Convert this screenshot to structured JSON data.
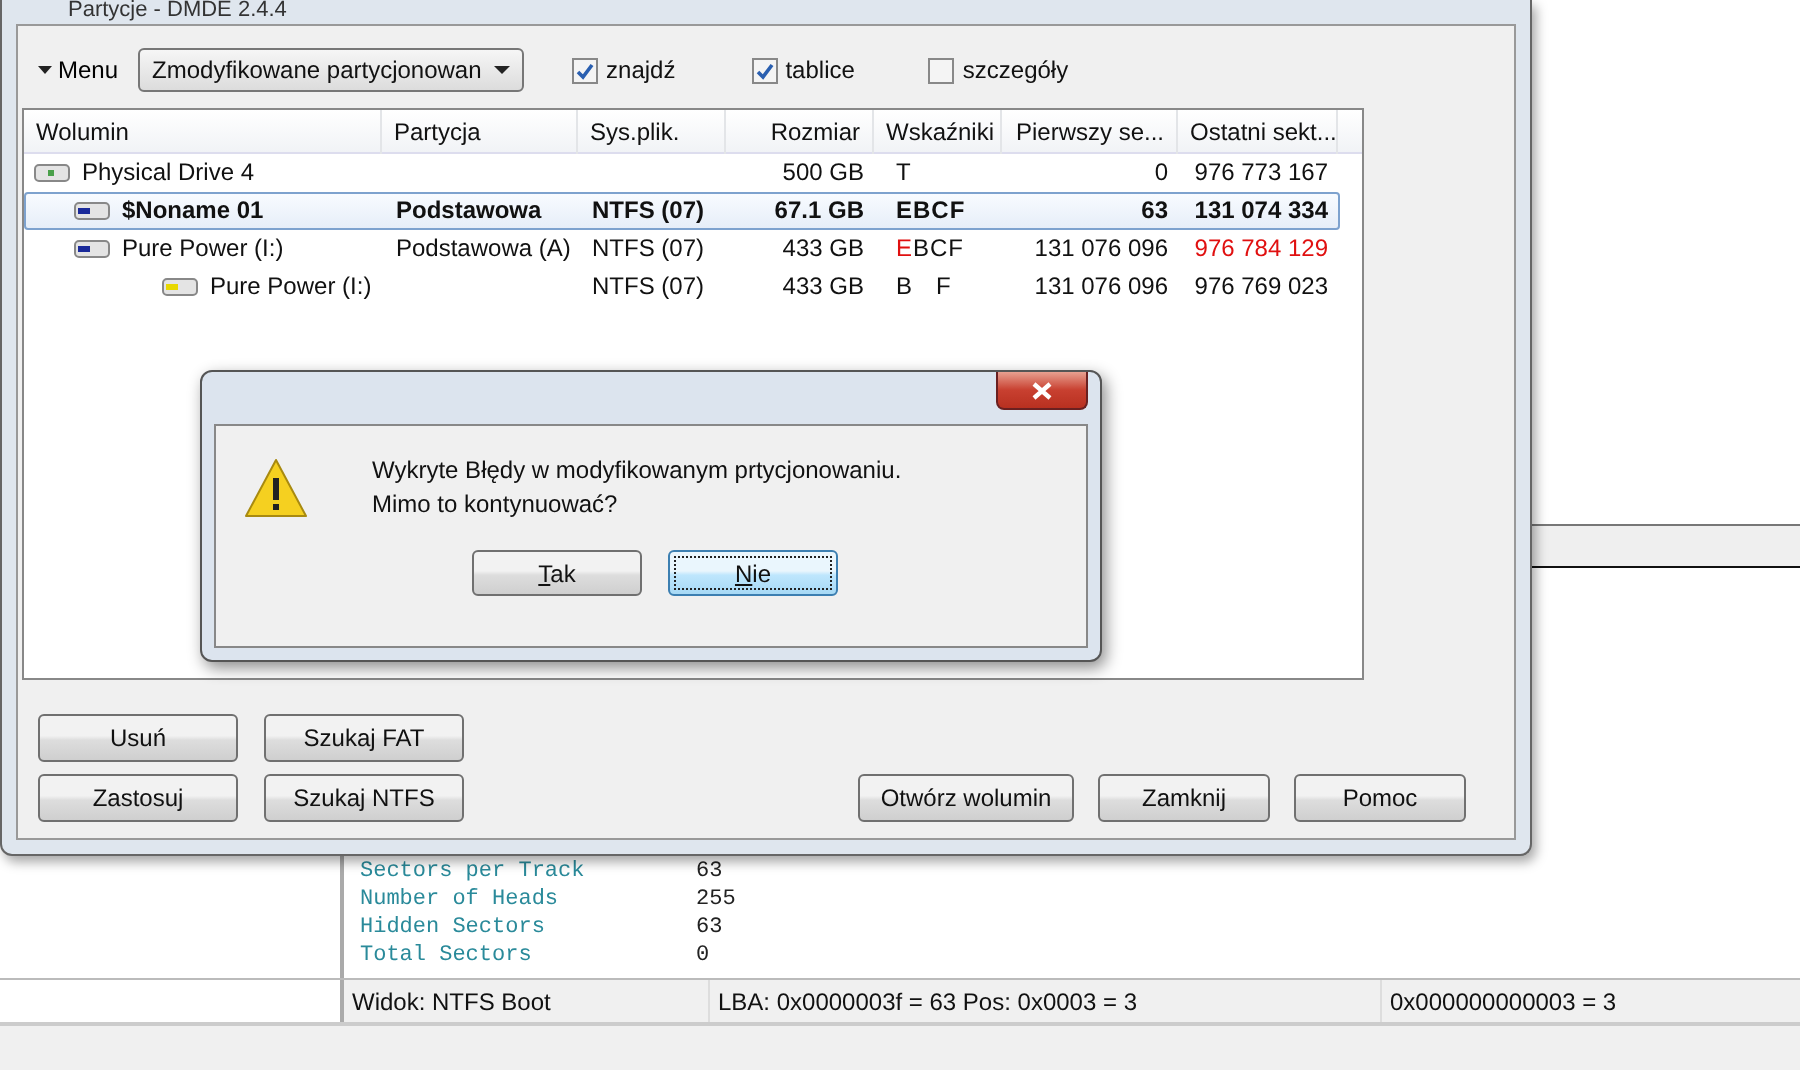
{
  "window": {
    "title": "Partycje - DMDE 2.4.4"
  },
  "toolbar": {
    "menu": "Menu",
    "view_select": "Zmodyfikowane partycjonowan",
    "checkboxes": [
      {
        "label": "znajdź",
        "checked": true
      },
      {
        "label": "tablice",
        "checked": true
      },
      {
        "label": "szczegóły",
        "checked": false
      }
    ]
  },
  "table": {
    "columns": [
      "Wolumin",
      "Partycja",
      "Sys.plik.",
      "Rozmiar",
      "Wskaźniki",
      "Pierwszy se...",
      "Ostatni sekt..."
    ],
    "rows": [
      {
        "kind": "drive",
        "name": "Physical Drive 4",
        "size": "500 GB",
        "flags": [
          {
            "text": "T",
            "error": false
          }
        ],
        "first_sector": "0",
        "last_sector": "976 773 167",
        "last_sector_error": false,
        "selected": false,
        "children": [
          {
            "kind": "partition",
            "name": "$Noname 01",
            "partition": "Podstawowa",
            "fs": "NTFS (07)",
            "size": "67.1 GB",
            "flags": [
              {
                "text": "EBCF",
                "error": false
              }
            ],
            "first_sector": "63",
            "last_sector": "131 074 334",
            "last_sector_error": false,
            "selected": true
          },
          {
            "kind": "partition",
            "name": "Pure Power (I:)",
            "partition": "Podstawowa (A)",
            "fs": "NTFS (07)",
            "size": "433 GB",
            "flags": [
              {
                "text": "E",
                "error": true
              },
              {
                "text": "BCF",
                "error": false
              }
            ],
            "first_sector": "131 076 096",
            "last_sector": "976 784 129",
            "last_sector_error": true,
            "selected": false,
            "children": [
              {
                "kind": "volume",
                "name": "Pure Power (I:)",
                "fs": "NTFS (07)",
                "size": "433 GB",
                "flags": [
                  {
                    "text": "B   F",
                    "error": false
                  }
                ],
                "first_sector": "131 076 096",
                "last_sector": "976 769 023",
                "last_sector_error": false,
                "selected": false
              }
            ]
          }
        ]
      }
    ]
  },
  "buttons_left": [
    [
      "Usuń",
      "Szukaj FAT"
    ],
    [
      "Zastosuj",
      "Szukaj NTFS"
    ]
  ],
  "buttons_right": [
    "Otwórz wolumin",
    "Zamknij",
    "Pomoc"
  ],
  "dialog": {
    "message": [
      "Wykryte Błędy w modyfikowanym prtycjonowaniu.",
      "Mimo to kontynuować?"
    ],
    "buttons": [
      {
        "label": "Tak",
        "selected": false
      },
      {
        "label": "Nie",
        "selected": true
      }
    ]
  },
  "background": {
    "fields": [
      {
        "label": "Sectors per Track",
        "value": "63"
      },
      {
        "label": "Number of Heads",
        "value": "255"
      },
      {
        "label": "Hidden Sectors",
        "value": "63"
      },
      {
        "label": "Total Sectors",
        "value": "0"
      }
    ],
    "status_bar": [
      "Widok: NTFS Boot",
      "LBA: 0x0000003f = 63  Pos: 0x0003 = 3",
      "0x000000000003 = 3"
    ]
  }
}
